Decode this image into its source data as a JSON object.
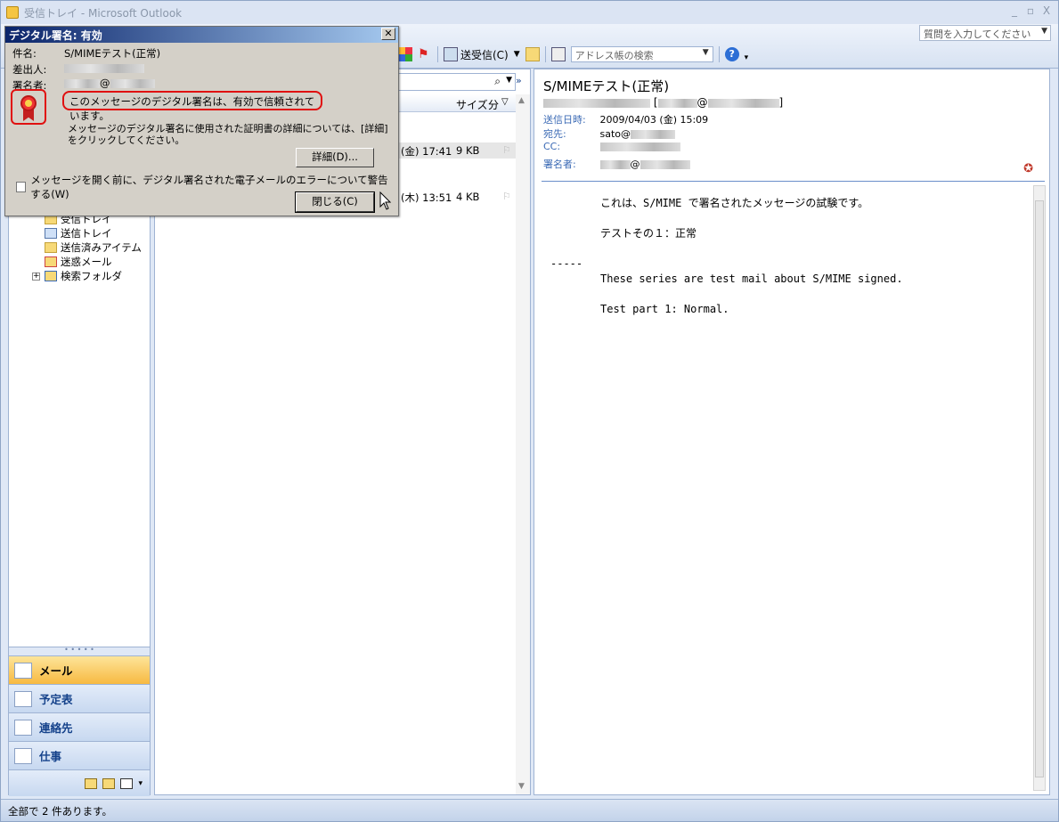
{
  "window": {
    "title": "受信トレイ - Microsoft Outlook",
    "minimize": "_",
    "maximize": "▫",
    "close": "X"
  },
  "toolbar": {
    "help_search_placeholder": "質問を入力してください",
    "send_receive_label": "送受信(C)",
    "address_search_placeholder": "アドレス帳の検索"
  },
  "folders": [
    {
      "label": "受信トレイ"
    },
    {
      "label": "送信トレイ"
    },
    {
      "label": "送信済みアイテム"
    },
    {
      "label": "迷惑メール"
    },
    {
      "label": "検索フォルダ",
      "expander": "+"
    }
  ],
  "nav_buttons": [
    {
      "label": "メール",
      "icon": "mail-icon"
    },
    {
      "label": "予定表",
      "icon": "calendar-icon"
    },
    {
      "label": "連絡先",
      "icon": "contacts-icon"
    },
    {
      "label": "仕事",
      "icon": "tasks-icon"
    }
  ],
  "message_list": {
    "columns": [
      "サイズ",
      "分"
    ],
    "rows": [
      {
        "date": "(金) 17:41",
        "size": "9 KB",
        "selected": true
      },
      {
        "date": "(木) 13:51",
        "size": "4 KB",
        "selected": false
      }
    ]
  },
  "reader": {
    "subject": "S/MIMEテスト(正常)",
    "from_suffix": "@",
    "fields": [
      {
        "label": "送信日時:",
        "value": "2009/04/03 (金) 15:09"
      },
      {
        "label": "宛先:",
        "value": "sato@"
      },
      {
        "label": "CC:",
        "value": ""
      },
      {
        "label": "署名者:",
        "value": "@"
      }
    ],
    "body": [
      "これは、S/MIME で署名されたメッセージの試験です。",
      "テストその１：正常",
      "-----",
      "These series are test mail about S/MIME signed.",
      "Test part 1: Normal."
    ]
  },
  "dialog": {
    "title": "デジタル署名: 有効",
    "subject_label": "件名:",
    "subject_value": "S/MIMEテスト(正常)",
    "sender_label": "差出人:",
    "signer_label": "署名者:",
    "signer_value_at": "@",
    "status_message": "このメッセージのデジタル署名は、有効で信頼されています。",
    "info_text": "メッセージのデジタル署名に使用された証明書の詳細については、[詳細] をクリックしてください。",
    "details_button": "詳細(D)...",
    "warn_checkbox": "メッセージを開く前に、デジタル署名された電子メールのエラーについて警告する(W)",
    "close_button": "閉じる(C)"
  },
  "statusbar": {
    "text": "全部で 2 件あります。"
  },
  "colors": {
    "accent": "#15428b",
    "active_nav": "#f7b941",
    "highlight": "#e01010"
  }
}
